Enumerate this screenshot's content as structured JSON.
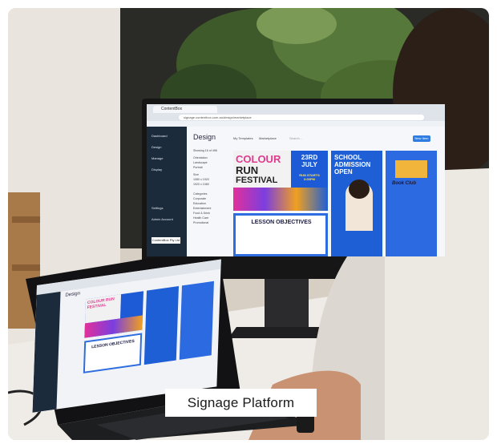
{
  "caption": {
    "text": "Signage Platform"
  },
  "monitor": {
    "tab_title": "ContentBox",
    "url": "signage.contentbox.com.au/design/marketplace",
    "app_heading": "Design",
    "tabs": [
      "My Templates",
      "Marketplace"
    ],
    "search_placeholder": "Search...",
    "new_button": "New Item",
    "sidebar": [
      "Dashboard",
      "Design",
      "Manage",
      "Display",
      "Settings",
      "Admin Account"
    ],
    "sidebar_company": "ContentBox Pty Ltd",
    "filters": [
      "Showing 16 of 498",
      "Orientation",
      "Landscape",
      "Portrait",
      "Size",
      "1080 x 1920",
      "1920 x 1080",
      "Categories",
      "Corporate",
      "Education",
      "Entertainment",
      "Food & Drink",
      "Health Care",
      "Promotional"
    ],
    "cards": [
      {
        "line1": "COLOUR",
        "line2": "RUN",
        "line3": "FESTIVAL",
        "date": "23RD JULY",
        "note": "RUN STARTS 3:00PM",
        "sub": "LESSON OBJECTIVES"
      },
      {
        "line1": "SCHOOL",
        "line2": "ADMISSION",
        "line3": "OPEN"
      },
      {
        "line1": "Book Club"
      }
    ]
  },
  "laptop": {
    "heading": "Design",
    "card_colour": "COLOUR RUN FESTIVAL",
    "card_lesson": "LESSON OBJECTIVES"
  },
  "colors": {
    "accent": "#2f7de1",
    "sidebar": "#1c2b3c",
    "poster_blue": "#1e5fd6",
    "poster_pink": "#e2309a"
  }
}
